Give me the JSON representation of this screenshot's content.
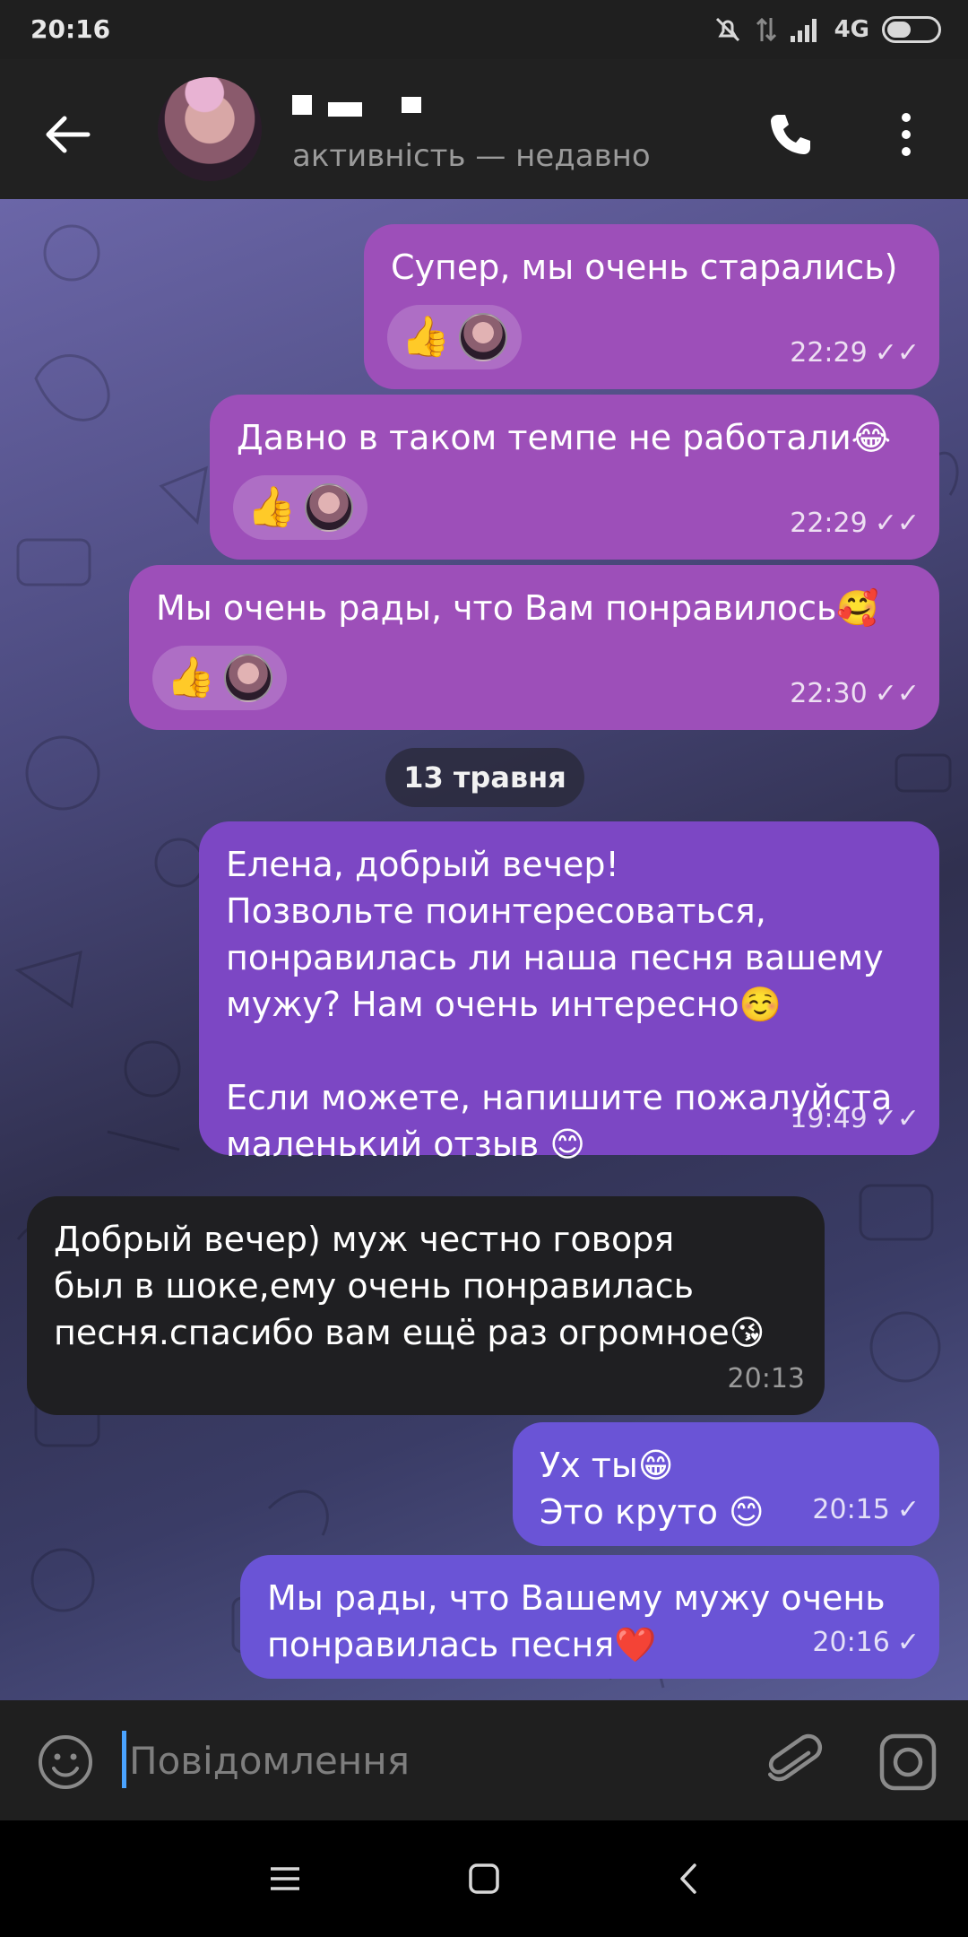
{
  "status_bar": {
    "time": "20:16",
    "network": "4G"
  },
  "header": {
    "contact_status": "активність — недавно"
  },
  "chat": {
    "date_separator": "13 травня",
    "messages": [
      {
        "text": "Супер, мы очень старались)",
        "time": "22:29",
        "ticks": "✓✓"
      },
      {
        "text": "Давно в таком темпе не работали😂",
        "time": "22:29",
        "ticks": "✓✓"
      },
      {
        "text": "Мы очень рады, что Вам понравилось🥰",
        "time": "22:30",
        "ticks": "✓✓"
      },
      {
        "text": "Елена, добрый вечер!\nПозвольте поинтересоваться,\nпонравилась ли наша песня вашему\nмужу? Нам очень интересно☺️\n\nЕсли можете, напишите пожалуйста\nмаленький отзыв 😊",
        "time": "19:49",
        "ticks": "✓✓"
      },
      {
        "text": "Добрый вечер) муж честно говоря\nбыл в шоке,ему очень понравилась\nпесня.спасибо вам ещё раз огромное😘",
        "time": "20:13"
      },
      {
        "text": "Ух ты😁\nЭто круто 😊",
        "time": "20:15",
        "ticks": "✓"
      },
      {
        "text": "Мы рады, что Вашему мужу очень\nпонравилась песня❤️",
        "time": "20:16",
        "ticks": "✓"
      }
    ],
    "reaction_emoji": "👍"
  },
  "input": {
    "placeholder": "Повідомлення"
  },
  "colors": {
    "bubble_purple": "#9d4fb9",
    "bubble_violet": "#7c47c4",
    "bubble_blue_violet": "#6a54d6",
    "bubble_incoming": "#1f1f22",
    "cursor": "#4aa3ff"
  },
  "icons": [
    "back-arrow-icon",
    "phone-icon",
    "more-vertical-icon",
    "emoji-icon",
    "attach-icon",
    "camera-icon",
    "menu-icon",
    "home-icon",
    "back-nav-icon",
    "double-check-icon",
    "check-icon"
  ]
}
